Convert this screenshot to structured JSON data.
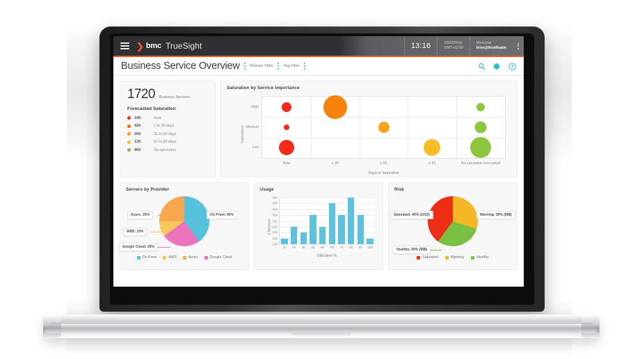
{
  "app": {
    "brand_mark": "bmc",
    "brand_word": "bmc",
    "product": "TrueSight",
    "menu_icon": "hamburger-icon",
    "clock": "13:16",
    "date": "22/02/2016",
    "timezone": "GMT+02:00",
    "welcome_label": "Welcome",
    "user": "liron@lironRealm",
    "accent": "#f05a22"
  },
  "pagebar": {
    "title": "Business Service Overview",
    "filters": [
      "Domain Filter",
      "Tag Filter"
    ],
    "icons": [
      "search-icon",
      "gear-icon",
      "help-icon"
    ],
    "icon_color": "#18b9c4"
  },
  "kpi": {
    "count": "1720",
    "count_caption": "Business Services",
    "section_title": "Forecasted Saturation",
    "rows": [
      {
        "value": "100",
        "label": "Now",
        "color": "#ee2d16"
      },
      {
        "value": "420",
        "label": "1 to 30 days",
        "color": "#f5690c"
      },
      {
        "value": "200",
        "label": "31 to 60 days",
        "color": "#f7941e"
      },
      {
        "value": "125",
        "label": "61 to 90 days",
        "color": "#f6bf26"
      },
      {
        "value": "900",
        "label": "No saturation",
        "color": "#7ac143"
      }
    ]
  },
  "chart_data": [
    {
      "id": "saturation-by-service-importance",
      "type": "scatter",
      "title": "Saturation by Service Importance",
      "xlabel": "Days to Saturation",
      "ylabel": "Importance",
      "x_categories": [
        "Now",
        "≤ 30",
        "≤ 60",
        "≤ 90",
        "No saturation forecasted"
      ],
      "y_categories": [
        "High",
        "Medium",
        "Low"
      ],
      "grid": true,
      "legend": "none",
      "points": [
        {
          "x": "Now",
          "y": "High",
          "size": 14,
          "color": "#f42b18"
        },
        {
          "x": "Now",
          "y": "Medium",
          "size": 8,
          "color": "#f42b18"
        },
        {
          "x": "Now",
          "y": "Low",
          "size": 22,
          "color": "#f42b18"
        },
        {
          "x": "≤ 30",
          "y": "High",
          "size": 34,
          "color": "#f5820b"
        },
        {
          "x": "≤ 60",
          "y": "Medium",
          "size": 16,
          "color": "#f7a41c"
        },
        {
          "x": "≤ 90",
          "y": "Low",
          "size": 24,
          "color": "#f5bd25"
        },
        {
          "x": "No saturation forecasted",
          "y": "High",
          "size": 12,
          "color": "#8ec63f"
        },
        {
          "x": "No saturation forecasted",
          "y": "Medium",
          "size": 17,
          "color": "#8ec63f"
        },
        {
          "x": "No saturation forecasted",
          "y": "Low",
          "size": 30,
          "color": "#8ec63f"
        }
      ]
    },
    {
      "id": "servers-by-provider",
      "type": "pie",
      "title": "Servers by Provider",
      "slices": [
        {
          "name": "On Prem",
          "value": 40,
          "label": "On Prem: 40%",
          "color": "#56c1dd"
        },
        {
          "name": "Google Cloud",
          "value": 25,
          "label": "Google Cloud: 25%",
          "color": "#ec74bc"
        },
        {
          "name": "AWS",
          "value": 10,
          "label": "AWS: 10%",
          "color": "#f8c85c"
        },
        {
          "name": "Azure",
          "value": 25,
          "label": "Azure: 25%",
          "color": "#f7a84f"
        }
      ],
      "legend": [
        "On Prem",
        "AWS",
        "Azure",
        "Google Cloud"
      ],
      "legend_position": "bottom"
    },
    {
      "id": "usage",
      "type": "bar",
      "title": "Usage",
      "xlabel": "Utilization %",
      "ylabel": "# Services",
      "categories": [
        "10",
        "20",
        "30",
        "40",
        "50",
        "60",
        "70",
        "80",
        "90",
        "100"
      ],
      "values": [
        150,
        250,
        200,
        350,
        250,
        450,
        350,
        500,
        350,
        150
      ],
      "yticks": [
        "100",
        "150",
        "200",
        "250",
        "300",
        "350",
        "400",
        "450",
        "500"
      ],
      "ylim": [
        100,
        500
      ],
      "bar_color": "#5cc2dd",
      "grid": true
    },
    {
      "id": "risk",
      "type": "pie",
      "title": "Risk",
      "slices": [
        {
          "name": "Warning",
          "value": 30,
          "label": "Warning: 30% (988)",
          "count": 988,
          "color": "#f6b726"
        },
        {
          "name": "Healthy",
          "value": 30,
          "label": "Healthy: 30% (988)",
          "count": 988,
          "color": "#7ac143"
        },
        {
          "name": "Saturated",
          "value": 40,
          "label": "Saturated: 40% (1032)",
          "count": 1032,
          "color": "#ee2d16"
        }
      ],
      "legend": [
        "Saturated",
        "Warning",
        "Healthy"
      ],
      "legend_position": "bottom"
    }
  ]
}
